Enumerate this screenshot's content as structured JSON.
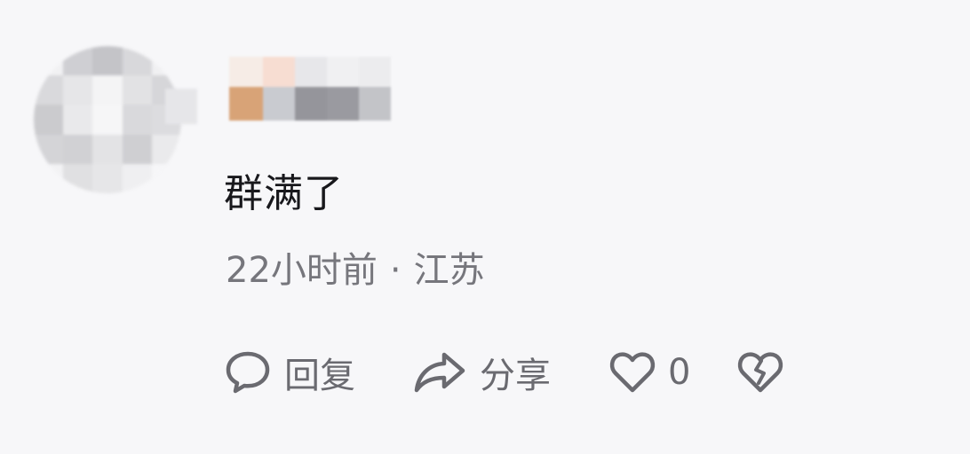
{
  "comment": {
    "text": "群满了",
    "time": "22小时前",
    "separator": "·",
    "location": "江苏"
  },
  "actions": {
    "reply": {
      "label": "回复",
      "icon": "speech-bubble-icon"
    },
    "share": {
      "label": "分享",
      "icon": "share-arrow-icon"
    },
    "like": {
      "count": "0",
      "icon": "heart-icon"
    },
    "dislike": {
      "icon": "broken-heart-icon"
    }
  },
  "colors": {
    "background": "#f7f7f9",
    "text_primary": "#18181c",
    "text_secondary": "#76767c",
    "icon": "#6a6a70"
  },
  "avatar_mosaic": [
    "#f1f1f3",
    "#cfcfd3",
    "#c4c4c8",
    "#d8d8db",
    "#f0f0f2",
    "#d9d9dc",
    "#e6e6e8",
    "#f4f4f5",
    "#e2e2e4",
    "#d6d6d9",
    "#cbcbce",
    "#e9e9eb",
    "#f6f6f7",
    "#d9d9dc",
    "#dcdcdf",
    "#d4d4d7",
    "#d1d1d4",
    "#e3e3e5",
    "#cfcfd2",
    "#eaeaec",
    "#f2f2f4",
    "#e0e0e2",
    "#e6e6e8",
    "#efeff1",
    "#f6f6f8"
  ],
  "username_mosaic": [
    "#f6ece6",
    "#f7ddd2",
    "#e7e7ea",
    "#f0f0f2",
    "#ececee",
    "#d8a377",
    "#c9cbd0",
    "#95959b",
    "#9a9aa0",
    "#c3c4c8"
  ]
}
